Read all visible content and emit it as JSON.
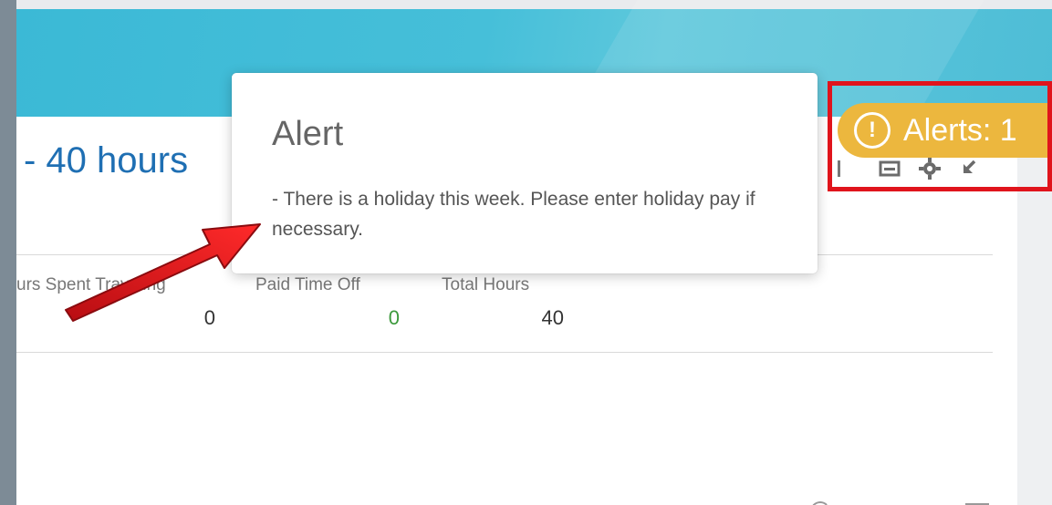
{
  "page": {
    "title": "- 40 hours"
  },
  "stats": {
    "items": [
      {
        "label": "urs Spent Traveling",
        "value": "0"
      },
      {
        "label": "Paid Time Off",
        "value": "0",
        "value_color": "#3d9a3d"
      },
      {
        "label": "Total Hours",
        "value": "40"
      }
    ]
  },
  "alert_popup": {
    "title": "Alert",
    "message": "- There is a holiday this week. Please enter holiday pay if necessary."
  },
  "alerts_button": {
    "icon": "exclamation-circle-icon",
    "label": "Alerts: 1"
  },
  "toolbar": {
    "icons": [
      "menu-icon",
      "print-icon",
      "gear-icon",
      "collapse-icon"
    ]
  },
  "annotation": {
    "arrow_color": "#e0141c",
    "highlight_color": "#e0141c"
  }
}
